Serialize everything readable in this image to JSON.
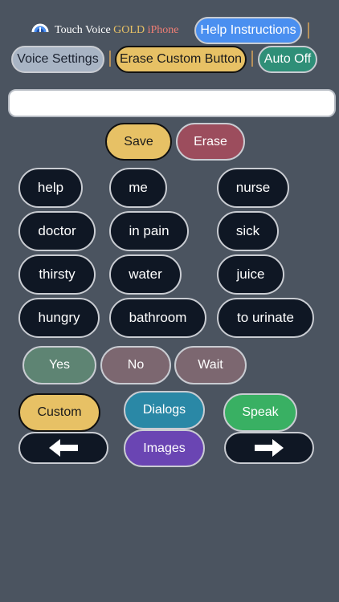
{
  "header": {
    "app_name": "Touch Voice",
    "gold": "GOLD",
    "platform": "iPhone",
    "help_button": "Help Instructions",
    "voice_settings_button": "Voice Settings",
    "erase_custom_button": "Erase Custom Button",
    "auto_off_button": "Auto Off"
  },
  "text_field": {
    "value": "",
    "placeholder": ""
  },
  "actions": {
    "save": "Save",
    "erase": "Erase"
  },
  "words": [
    "help",
    "me",
    "nurse",
    "doctor",
    "in pain",
    "sick",
    "thirsty",
    "water",
    "juice",
    "hungry",
    "bathroom",
    "to urinate"
  ],
  "responses": {
    "yes": "Yes",
    "no": "No",
    "wait": "Wait"
  },
  "bottom": {
    "custom": "Custom",
    "dialogs": "Dialogs",
    "speak": "Speak",
    "images": "Images",
    "prev_icon": "arrow-left-icon",
    "next_icon": "arrow-right-icon"
  },
  "colors": {
    "background": "#4b5460",
    "gold": "#e7c165",
    "help_blue": "#4a8ff0",
    "auto_off_green": "#2f8f78",
    "erase_red": "#9c4d5d",
    "yes_green": "#5e8473",
    "no_mauve": "#7c6770",
    "dialogs_teal": "#2a88a6",
    "speak_green": "#39b063",
    "images_purple": "#6a45b3"
  }
}
